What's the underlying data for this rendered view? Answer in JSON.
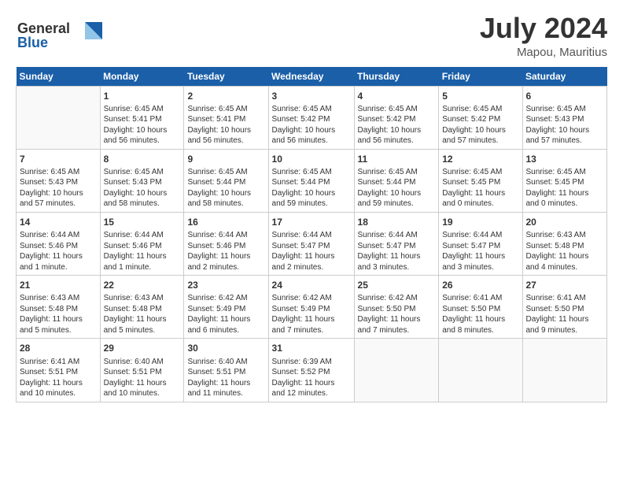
{
  "logo": {
    "line1": "General",
    "line2": "Blue"
  },
  "title": "July 2024",
  "location": "Mapou, Mauritius",
  "days_header": [
    "Sunday",
    "Monday",
    "Tuesday",
    "Wednesday",
    "Thursday",
    "Friday",
    "Saturday"
  ],
  "weeks": [
    [
      {
        "num": "",
        "info": ""
      },
      {
        "num": "1",
        "info": "Sunrise: 6:45 AM\nSunset: 5:41 PM\nDaylight: 10 hours\nand 56 minutes."
      },
      {
        "num": "2",
        "info": "Sunrise: 6:45 AM\nSunset: 5:41 PM\nDaylight: 10 hours\nand 56 minutes."
      },
      {
        "num": "3",
        "info": "Sunrise: 6:45 AM\nSunset: 5:42 PM\nDaylight: 10 hours\nand 56 minutes."
      },
      {
        "num": "4",
        "info": "Sunrise: 6:45 AM\nSunset: 5:42 PM\nDaylight: 10 hours\nand 56 minutes."
      },
      {
        "num": "5",
        "info": "Sunrise: 6:45 AM\nSunset: 5:42 PM\nDaylight: 10 hours\nand 57 minutes."
      },
      {
        "num": "6",
        "info": "Sunrise: 6:45 AM\nSunset: 5:43 PM\nDaylight: 10 hours\nand 57 minutes."
      }
    ],
    [
      {
        "num": "7",
        "info": "Sunrise: 6:45 AM\nSunset: 5:43 PM\nDaylight: 10 hours\nand 57 minutes."
      },
      {
        "num": "8",
        "info": "Sunrise: 6:45 AM\nSunset: 5:43 PM\nDaylight: 10 hours\nand 58 minutes."
      },
      {
        "num": "9",
        "info": "Sunrise: 6:45 AM\nSunset: 5:44 PM\nDaylight: 10 hours\nand 58 minutes."
      },
      {
        "num": "10",
        "info": "Sunrise: 6:45 AM\nSunset: 5:44 PM\nDaylight: 10 hours\nand 59 minutes."
      },
      {
        "num": "11",
        "info": "Sunrise: 6:45 AM\nSunset: 5:44 PM\nDaylight: 10 hours\nand 59 minutes."
      },
      {
        "num": "12",
        "info": "Sunrise: 6:45 AM\nSunset: 5:45 PM\nDaylight: 11 hours\nand 0 minutes."
      },
      {
        "num": "13",
        "info": "Sunrise: 6:45 AM\nSunset: 5:45 PM\nDaylight: 11 hours\nand 0 minutes."
      }
    ],
    [
      {
        "num": "14",
        "info": "Sunrise: 6:44 AM\nSunset: 5:46 PM\nDaylight: 11 hours\nand 1 minute."
      },
      {
        "num": "15",
        "info": "Sunrise: 6:44 AM\nSunset: 5:46 PM\nDaylight: 11 hours\nand 1 minute."
      },
      {
        "num": "16",
        "info": "Sunrise: 6:44 AM\nSunset: 5:46 PM\nDaylight: 11 hours\nand 2 minutes."
      },
      {
        "num": "17",
        "info": "Sunrise: 6:44 AM\nSunset: 5:47 PM\nDaylight: 11 hours\nand 2 minutes."
      },
      {
        "num": "18",
        "info": "Sunrise: 6:44 AM\nSunset: 5:47 PM\nDaylight: 11 hours\nand 3 minutes."
      },
      {
        "num": "19",
        "info": "Sunrise: 6:44 AM\nSunset: 5:47 PM\nDaylight: 11 hours\nand 3 minutes."
      },
      {
        "num": "20",
        "info": "Sunrise: 6:43 AM\nSunset: 5:48 PM\nDaylight: 11 hours\nand 4 minutes."
      }
    ],
    [
      {
        "num": "21",
        "info": "Sunrise: 6:43 AM\nSunset: 5:48 PM\nDaylight: 11 hours\nand 5 minutes."
      },
      {
        "num": "22",
        "info": "Sunrise: 6:43 AM\nSunset: 5:48 PM\nDaylight: 11 hours\nand 5 minutes."
      },
      {
        "num": "23",
        "info": "Sunrise: 6:42 AM\nSunset: 5:49 PM\nDaylight: 11 hours\nand 6 minutes."
      },
      {
        "num": "24",
        "info": "Sunrise: 6:42 AM\nSunset: 5:49 PM\nDaylight: 11 hours\nand 7 minutes."
      },
      {
        "num": "25",
        "info": "Sunrise: 6:42 AM\nSunset: 5:50 PM\nDaylight: 11 hours\nand 7 minutes."
      },
      {
        "num": "26",
        "info": "Sunrise: 6:41 AM\nSunset: 5:50 PM\nDaylight: 11 hours\nand 8 minutes."
      },
      {
        "num": "27",
        "info": "Sunrise: 6:41 AM\nSunset: 5:50 PM\nDaylight: 11 hours\nand 9 minutes."
      }
    ],
    [
      {
        "num": "28",
        "info": "Sunrise: 6:41 AM\nSunset: 5:51 PM\nDaylight: 11 hours\nand 10 minutes."
      },
      {
        "num": "29",
        "info": "Sunrise: 6:40 AM\nSunset: 5:51 PM\nDaylight: 11 hours\nand 10 minutes."
      },
      {
        "num": "30",
        "info": "Sunrise: 6:40 AM\nSunset: 5:51 PM\nDaylight: 11 hours\nand 11 minutes."
      },
      {
        "num": "31",
        "info": "Sunrise: 6:39 AM\nSunset: 5:52 PM\nDaylight: 11 hours\nand 12 minutes."
      },
      {
        "num": "",
        "info": ""
      },
      {
        "num": "",
        "info": ""
      },
      {
        "num": "",
        "info": ""
      }
    ]
  ]
}
